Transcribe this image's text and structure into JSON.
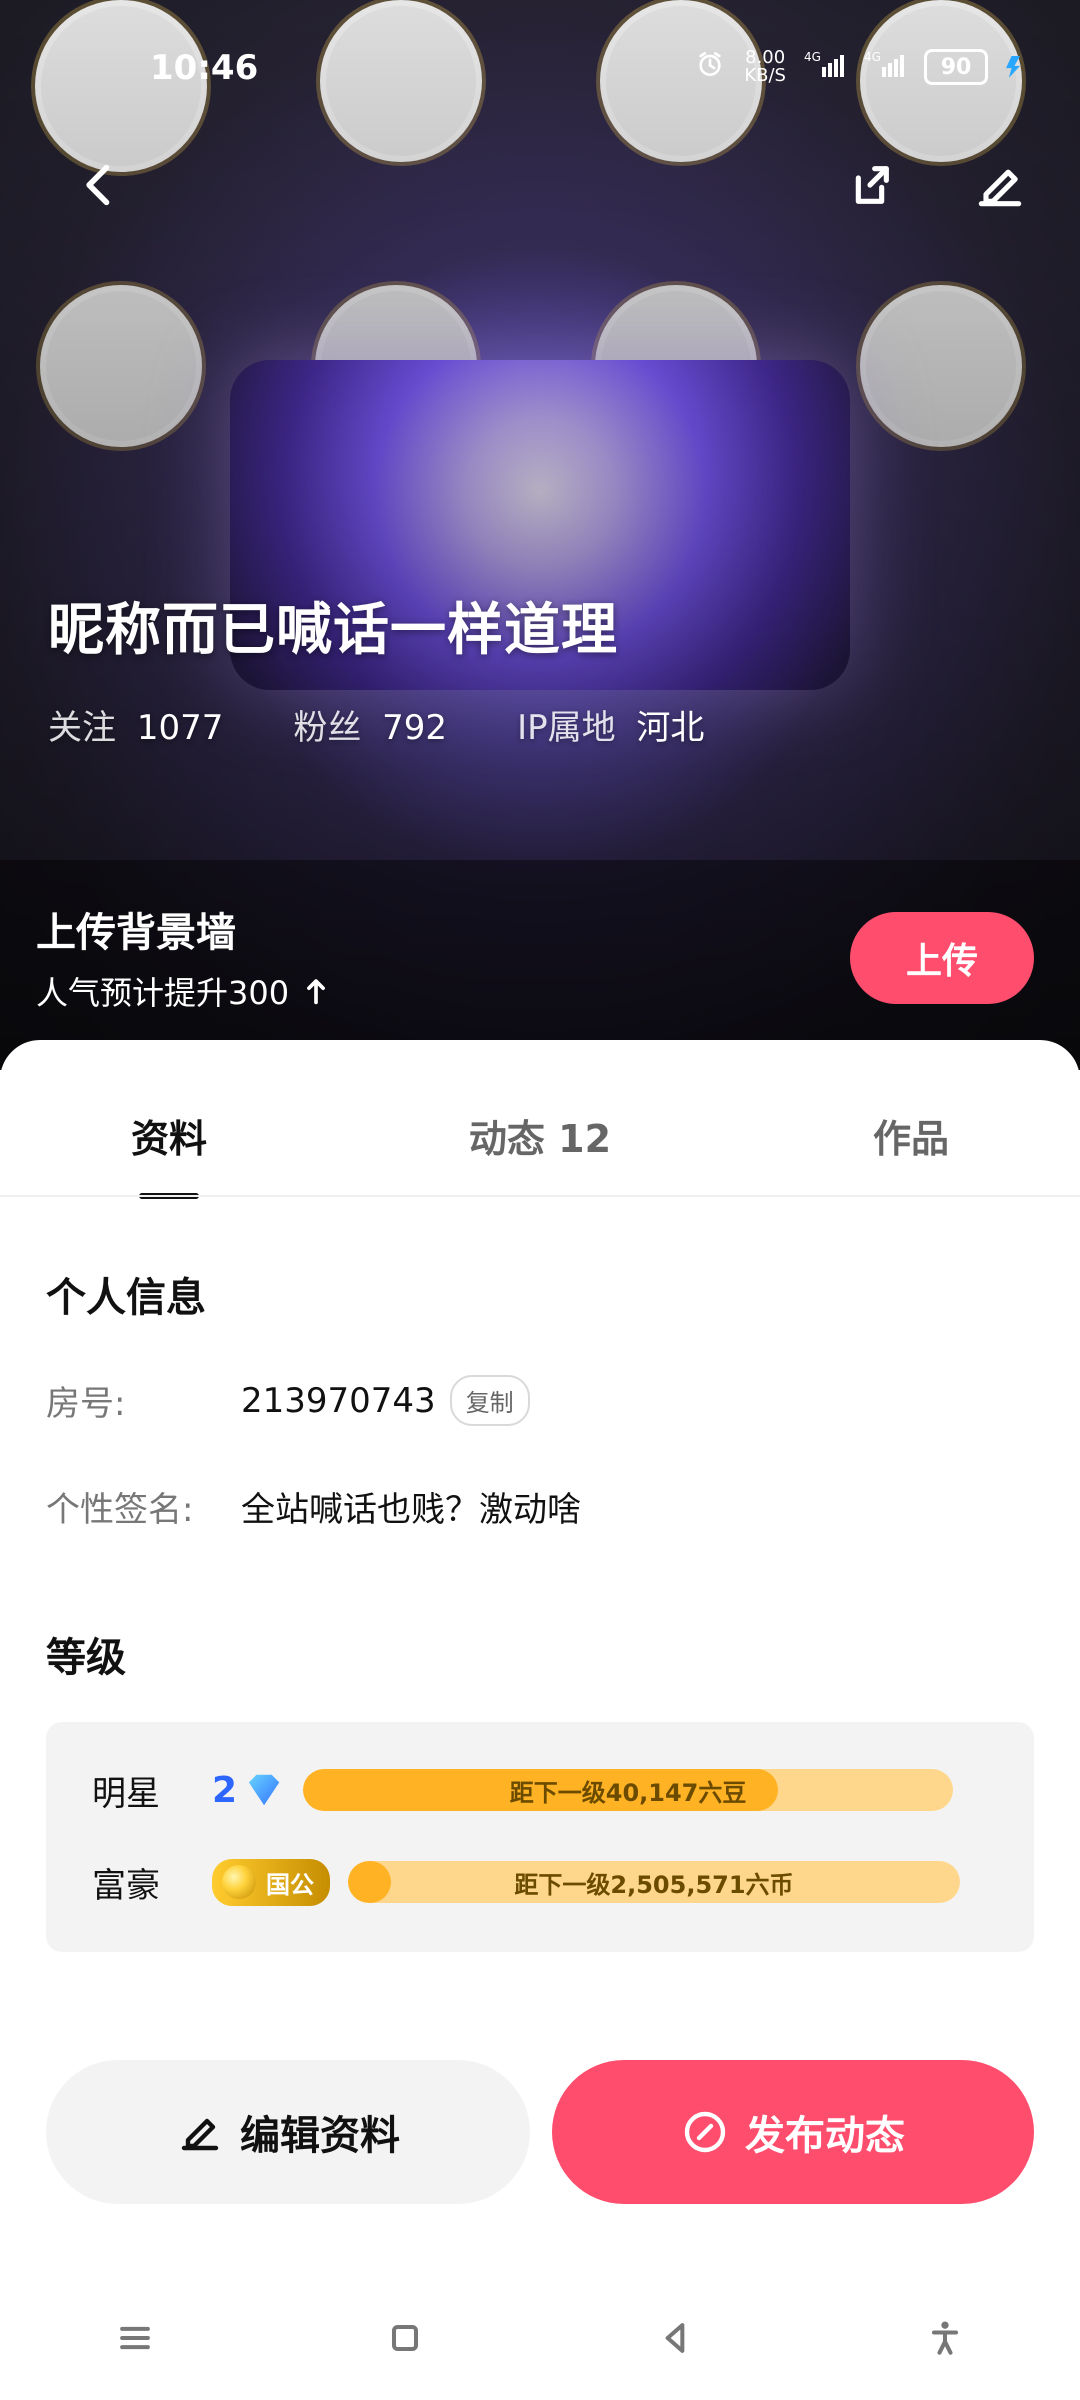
{
  "status": {
    "time": "10:46",
    "net_speed": "8.00",
    "net_unit": "KB/S",
    "sig1": "4G",
    "sig2": "4G",
    "battery": "90"
  },
  "header": {
    "back_icon": "back-icon",
    "share_icon": "share-icon",
    "edit_icon": "edit-icon"
  },
  "profile": {
    "nickname": "昵称而已喊话一样道理",
    "follow_label": "关注",
    "follow_count": "1077",
    "fans_label": "粉丝",
    "fans_count": "792",
    "ip_label": "IP属地",
    "ip_value": "河北"
  },
  "upload_bg": {
    "title": "上传背景墙",
    "subtitle": "人气预计提升300",
    "button": "上传"
  },
  "tabs": [
    {
      "label": "资料"
    },
    {
      "label": "动态 12"
    },
    {
      "label": "作品"
    }
  ],
  "personal_info": {
    "title": "个人信息",
    "room_label": "房号:",
    "room_value": "213970743",
    "copy_label": "复制",
    "signature_label": "个性签名:",
    "signature_value": "全站喊话也贱？激动啥"
  },
  "levels": {
    "title": "等级",
    "star": {
      "label": "明星",
      "level": "2",
      "progress": 0.73,
      "text": "距下一级40,147六豆"
    },
    "rich": {
      "label": "富豪",
      "badge": "国公",
      "progress": 0.07,
      "text": "距下一级2,505,571六币"
    }
  },
  "actions": {
    "edit": "编辑资料",
    "post": "发布动态"
  }
}
